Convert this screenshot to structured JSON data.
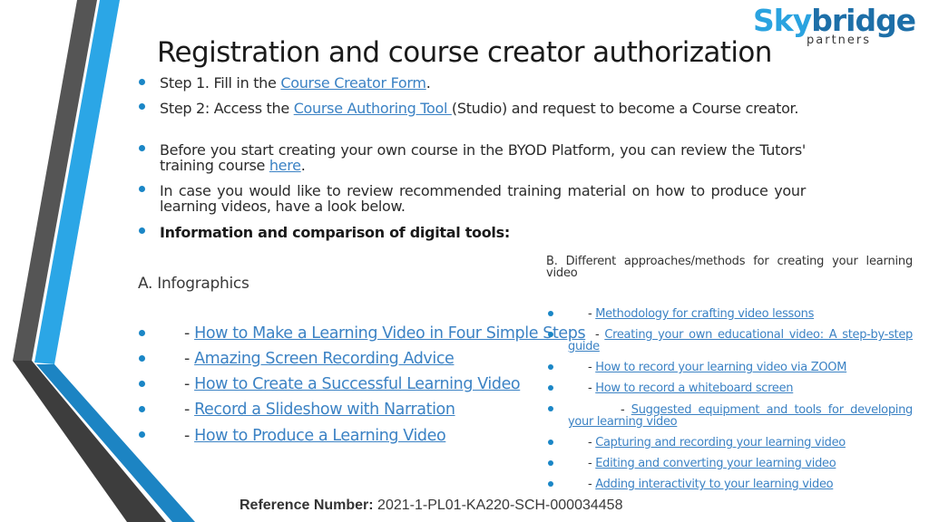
{
  "logo": {
    "part1": "Sky",
    "part2": "bridge",
    "sub": "partners"
  },
  "title": "Registration and course creator authorization",
  "bullets": [
    {
      "before": "Step 1. Fill in the ",
      "link": "Course Creator Form",
      "after": "."
    },
    {
      "before": "Step 2: Access the ",
      "link": "Course Authoring Tool ",
      "after": "(Studio) and request to become a Course creator."
    },
    {
      "before": "Before you start creating your own course in the BYOD Platform, you can review the Tutors' training course ",
      "link": "here",
      "after": "."
    },
    {
      "before": "In case you would like to review recommended training material on how to produce your learning videos, have a look below.",
      "link": "",
      "after": ""
    },
    {
      "bold": "Information and comparison of digital tools:"
    }
  ],
  "section_a": {
    "heading": "A. Infographics",
    "dash": "- ",
    "links": [
      "How to Make a Learning Video in Four Simple Steps",
      "Amazing Screen Recording Advice",
      "How to Create a Successful Learning Video",
      "Record a Slideshow with Narration",
      "How to Produce a Learning Video"
    ]
  },
  "section_b": {
    "heading": "B. Different approaches/methods for creating your learning video",
    "dash": "- ",
    "links": [
      "Methodology for crafting video lessons",
      "Creating your own educational video: A step-by-step guide",
      "How to record your learning video via ZOOM",
      "How to record a whiteboard screen",
      "Suggested equipment and tools for developing your learning video",
      "Capturing and recording your learning video",
      "Editing and converting your learning video",
      "Adding interactivity to your learning video"
    ]
  },
  "footer": {
    "label": "Reference Number:",
    "value": " 2021-1-PL01-KA220-SCH-000034458"
  },
  "colors": {
    "accent_blue": "#2ba6e6",
    "dark_blue": "#1a86c6",
    "dark_gray": "#555555",
    "link": "#3b82c4"
  }
}
